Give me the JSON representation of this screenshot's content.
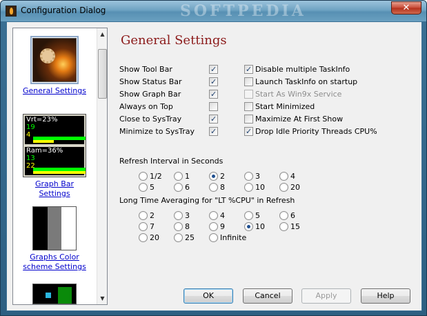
{
  "window": {
    "title": "Configuration Dialog",
    "watermark": "SOFTPEDIA",
    "close_label": "✕"
  },
  "sidebar": {
    "items": [
      {
        "label": "General Settings"
      },
      {
        "label": "Graph Bar Settings"
      },
      {
        "label": "Graphs Color scheme Settings"
      }
    ],
    "graph_thumb": {
      "vrt": "Vrt=23%",
      "vrt_a": "19",
      "vrt_b": "4",
      "ram": "Ram=36%",
      "ram_a": "13",
      "ram_b": "22"
    }
  },
  "main": {
    "heading": "General Settings",
    "left_options": [
      {
        "label": "Show Tool Bar",
        "checked": true
      },
      {
        "label": "Show Status Bar",
        "checked": true
      },
      {
        "label": "Show Graph Bar",
        "checked": true
      },
      {
        "label": "Always on Top",
        "checked": false
      },
      {
        "label": "Close to SysTray",
        "checked": true
      },
      {
        "label": "Minimize to SysTray",
        "checked": true
      }
    ],
    "right_options": [
      {
        "label": "Disable multiple TaskInfo",
        "checked": true,
        "disabled": false
      },
      {
        "label": "Launch TaskInfo on startup",
        "checked": false,
        "disabled": false
      },
      {
        "label": "Start As Win9x Service",
        "checked": false,
        "disabled": true
      },
      {
        "label": "Start Minimized",
        "checked": false,
        "disabled": false
      },
      {
        "label": "Maximize At First Show",
        "checked": false,
        "disabled": false
      },
      {
        "label": "Drop Idle Priority Threads CPU%",
        "checked": true,
        "disabled": false
      }
    ],
    "refresh": {
      "label": "Refresh Interval in Seconds",
      "options": [
        "1/2",
        "1",
        "2",
        "3",
        "4",
        "5",
        "6",
        "8",
        "10",
        "20"
      ],
      "selected": "2"
    },
    "averaging": {
      "label": "Long Time Averaging for \"LT %CPU\" in Refresh",
      "options": [
        "2",
        "3",
        "4",
        "5",
        "6",
        "7",
        "8",
        "9",
        "10",
        "15",
        "20",
        "25",
        "Infinite"
      ],
      "selected": "10"
    }
  },
  "buttons": {
    "ok": "OK",
    "cancel": "Cancel",
    "apply": "Apply",
    "help": "Help"
  }
}
